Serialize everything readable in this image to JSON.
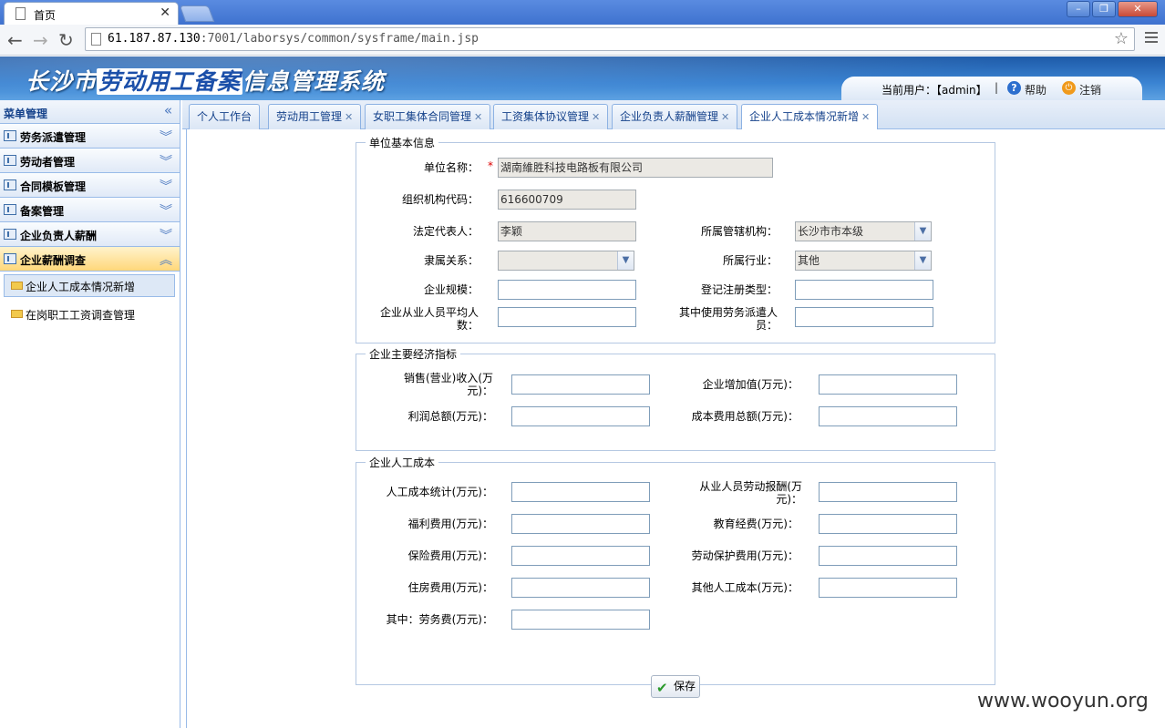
{
  "browser": {
    "tab_title": "首页",
    "url_host": "61.187.87.130",
    "url_rest": ":7001/laborsys/common/sysframe/main.jsp"
  },
  "header": {
    "title_prefix": "长沙市",
    "title_highlight": "劳动用工备案",
    "title_suffix": "信息管理系统",
    "current_user": "当前用户：【admin】",
    "help": "帮助",
    "logout": "注销"
  },
  "sidebar": {
    "title": "菜单管理",
    "groups": [
      {
        "label": "劳务派遣管理"
      },
      {
        "label": "劳动者管理"
      },
      {
        "label": "合同模板管理"
      },
      {
        "label": "备案管理"
      },
      {
        "label": "企业负责人薪酬"
      },
      {
        "label": "企业薪酬调查"
      }
    ],
    "subitems": [
      {
        "label": "企业人工成本情况新增"
      },
      {
        "label": "在岗职工工资调查管理"
      }
    ]
  },
  "tabs": [
    {
      "label": "个人工作台"
    },
    {
      "label": "劳动用工管理"
    },
    {
      "label": "女职工集体合同管理"
    },
    {
      "label": "工资集体协议管理"
    },
    {
      "label": "企业负责人薪酬管理"
    },
    {
      "label": "企业人工成本情况新增"
    }
  ],
  "form": {
    "section1": {
      "legend": "单位基本信息",
      "unit_name_label": "单位名称：",
      "unit_name_value": "湖南維胜科技电路板有限公司",
      "org_code_label": "组织机构代码：",
      "org_code_value": "616600709",
      "legal_rep_label": "法定代表人：",
      "legal_rep_value": "李颖",
      "jurisdiction_label": "所属管辖机构：",
      "jurisdiction_value": "长沙市市本级",
      "affiliation_label": "隶属关系：",
      "affiliation_value": "",
      "industry_label": "所属行业：",
      "industry_value": "其他",
      "scale_label": "企业规模：",
      "reg_type_label": "登记注册类型：",
      "avg_employees_label": "企业从业人员平均人数：",
      "dispatch_label": "其中使用劳务派遣人员："
    },
    "section2": {
      "legend": "企业主要经济指标",
      "sales_label": "销售(营业)收入(万元)：",
      "value_added_label": "企业增加值(万元)：",
      "profit_label": "利润总额(万元)：",
      "cost_total_label": "成本费用总额(万元)："
    },
    "section3": {
      "legend": "企业人工成本",
      "labor_cost_label": "人工成本统计(万元)：",
      "employee_pay_label": "从业人员劳动报酬(万元)：",
      "welfare_label": "福利费用(万元)：",
      "education_label": "教育经费(万元)：",
      "insurance_label": "保险费用(万元)：",
      "protection_label": "劳动保护费用(万元)：",
      "housing_label": "住房费用(万元)：",
      "other_cost_label": "其他人工成本(万元)：",
      "service_fee_label": "其中：劳务费(万元)："
    },
    "save_label": "保存"
  },
  "watermark": "www.wooyun.org"
}
